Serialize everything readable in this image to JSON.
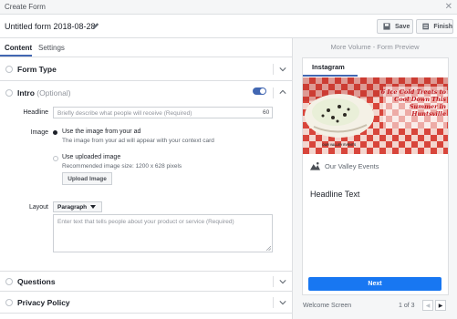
{
  "window": {
    "title": "Create Form",
    "close_glyph": "✕"
  },
  "form": {
    "name": "Untitled form 2018-08-28",
    "save_label": "Save",
    "finish_label": "Finish"
  },
  "tabs": {
    "content": "Content",
    "settings": "Settings"
  },
  "sections": {
    "form_type": "Form Type",
    "intro": "Intro",
    "intro_optional": "(Optional)",
    "questions": "Questions",
    "privacy": "Privacy Policy"
  },
  "intro": {
    "headline_label": "Headline",
    "headline_placeholder": "Briefly describe what people will receive (Required)",
    "headline_count": "60",
    "image_label": "Image",
    "use_ad_title": "Use the image from your ad",
    "use_ad_sub": "The image from your ad will appear with your context card",
    "use_upload_title": "Use uploaded image",
    "use_upload_sub": "Recommended image size: 1200 x 628 pixels",
    "upload_button": "Upload Image",
    "layout_label": "Layout",
    "layout_value": "Paragraph",
    "layout_placeholder": "Enter text that tells people about your product or service (Required)",
    "toggle_on": true
  },
  "preview": {
    "title": "More Volume - Form Preview",
    "tab": "Instagram",
    "hero_headline": "6 Ice Cold Treats to Cool Down This Summer in Huntsville",
    "hero_caption": "OUR VALLEY EVENTS",
    "brand": "Our Valley Events",
    "headline": "Headline Text",
    "next_button": "Next",
    "screen_label": "Welcome Screen",
    "pager": "1 of 3",
    "prev_glyph": "◀",
    "next_glyph": "▶"
  },
  "colors": {
    "accent": "#4267b2",
    "next_button": "#1877f2",
    "hero_text": "#c0151b"
  }
}
